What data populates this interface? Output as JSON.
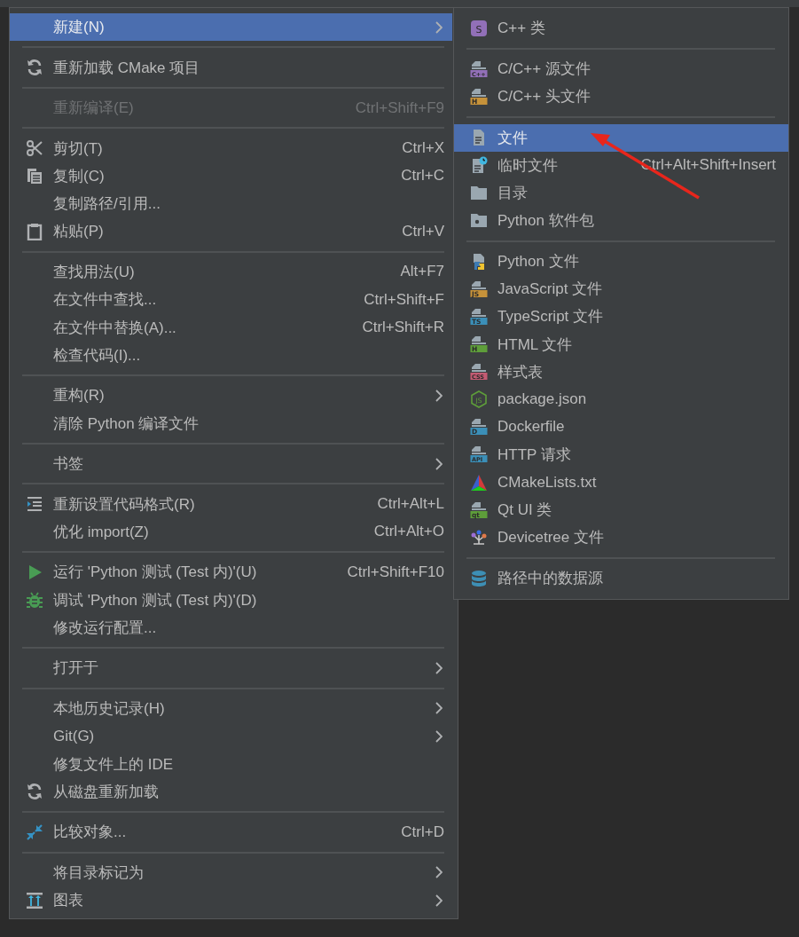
{
  "context_menu": {
    "items": [
      {
        "kind": "text",
        "label": "新建(N)",
        "submenu": true,
        "selected": true,
        "disabled": false
      },
      {
        "kind": "separator"
      },
      {
        "kind": "reload",
        "label": "重新加载 CMake 项目",
        "submenu": false,
        "selected": false,
        "disabled": false
      },
      {
        "kind": "separator"
      },
      {
        "kind": "text",
        "label": "重新编译(E)",
        "shortcut": "Ctrl+Shift+F9",
        "submenu": false,
        "selected": false,
        "disabled": true
      },
      {
        "kind": "separator"
      },
      {
        "kind": "scissors",
        "label": "剪切(T)",
        "shortcut": "Ctrl+X",
        "submenu": false,
        "selected": false,
        "disabled": false
      },
      {
        "kind": "copy",
        "label": "复制(C)",
        "shortcut": "Ctrl+C",
        "submenu": false,
        "selected": false,
        "disabled": false
      },
      {
        "kind": "text",
        "label": "复制路径/引用...",
        "submenu": false,
        "selected": false,
        "disabled": false
      },
      {
        "kind": "paste",
        "label": "粘贴(P)",
        "shortcut": "Ctrl+V",
        "submenu": false,
        "selected": false,
        "disabled": false
      },
      {
        "kind": "separator"
      },
      {
        "kind": "text",
        "label": "查找用法(U)",
        "shortcut": "Alt+F7",
        "submenu": false,
        "selected": false,
        "disabled": false
      },
      {
        "kind": "text",
        "label": "在文件中查找...",
        "shortcut": "Ctrl+Shift+F",
        "submenu": false,
        "selected": false,
        "disabled": false
      },
      {
        "kind": "text",
        "label": "在文件中替换(A)...",
        "shortcut": "Ctrl+Shift+R",
        "submenu": false,
        "selected": false,
        "disabled": false
      },
      {
        "kind": "text",
        "label": "检查代码(I)...",
        "submenu": false,
        "selected": false,
        "disabled": false
      },
      {
        "kind": "separator"
      },
      {
        "kind": "text",
        "label": "重构(R)",
        "submenu": true,
        "selected": false,
        "disabled": false
      },
      {
        "kind": "text",
        "label": "清除 Python 编译文件",
        "submenu": false,
        "selected": false,
        "disabled": false
      },
      {
        "kind": "separator"
      },
      {
        "kind": "text",
        "label": "书签",
        "submenu": true,
        "selected": false,
        "disabled": false
      },
      {
        "kind": "separator"
      },
      {
        "kind": "format",
        "label": "重新设置代码格式(R)",
        "shortcut": "Ctrl+Alt+L",
        "submenu": false,
        "selected": false,
        "disabled": false
      },
      {
        "kind": "text",
        "label": "优化 import(Z)",
        "shortcut": "Ctrl+Alt+O",
        "submenu": false,
        "selected": false,
        "disabled": false
      },
      {
        "kind": "separator"
      },
      {
        "kind": "run",
        "label": "运行 'Python 测试 (Test 内)'(U)",
        "shortcut": "Ctrl+Shift+F10",
        "submenu": false,
        "selected": false,
        "disabled": false
      },
      {
        "kind": "debug",
        "label": "调试 'Python 测试 (Test 内)'(D)",
        "submenu": false,
        "selected": false,
        "disabled": false
      },
      {
        "kind": "text",
        "label": "修改运行配置...",
        "submenu": false,
        "selected": false,
        "disabled": false
      },
      {
        "kind": "separator"
      },
      {
        "kind": "text",
        "label": "打开于",
        "submenu": true,
        "selected": false,
        "disabled": false
      },
      {
        "kind": "separator"
      },
      {
        "kind": "text",
        "label": "本地历史记录(H)",
        "submenu": true,
        "selected": false,
        "disabled": false
      },
      {
        "kind": "text",
        "label": "Git(G)",
        "submenu": true,
        "selected": false,
        "disabled": false
      },
      {
        "kind": "text",
        "label": "修复文件上的 IDE",
        "submenu": false,
        "selected": false,
        "disabled": false
      },
      {
        "kind": "reload",
        "label": "从磁盘重新加载",
        "submenu": false,
        "selected": false,
        "disabled": false
      },
      {
        "kind": "separator"
      },
      {
        "kind": "compare",
        "label": "比较对象...",
        "shortcut": "Ctrl+D",
        "submenu": false,
        "selected": false,
        "disabled": false
      },
      {
        "kind": "separator"
      },
      {
        "kind": "text",
        "label": "将目录标记为",
        "submenu": true,
        "selected": false,
        "disabled": false
      },
      {
        "kind": "diagram",
        "label": "图表",
        "submenu": true,
        "selected": false,
        "disabled": false
      }
    ]
  },
  "submenu": {
    "items": [
      {
        "kind": "class",
        "badge": "S",
        "color": "#9270b8",
        "label": "C++ 类",
        "selected": false
      },
      {
        "kind": "separator"
      },
      {
        "kind": "filetype",
        "badge": "C++",
        "color": "#9270b8",
        "label": "C/C++ 源文件",
        "selected": false
      },
      {
        "kind": "filetype",
        "badge": "H",
        "color": "#c6923a",
        "label": "C/C++ 头文件",
        "selected": false
      },
      {
        "kind": "separator"
      },
      {
        "kind": "file",
        "label": "文件",
        "selected": true
      },
      {
        "kind": "scratch",
        "label": "临时文件",
        "shortcut": "Ctrl+Alt+Shift+Insert",
        "selected": false
      },
      {
        "kind": "folder",
        "label": "目录",
        "selected": false
      },
      {
        "kind": "package",
        "label": "Python 软件包",
        "selected": false
      },
      {
        "kind": "separator"
      },
      {
        "kind": "python",
        "label": "Python 文件",
        "selected": false
      },
      {
        "kind": "filetype",
        "badge": "JS",
        "color": "#c6923a",
        "label": "JavaScript 文件",
        "selected": false
      },
      {
        "kind": "filetype",
        "badge": "TS",
        "color": "#3b8fb8",
        "label": "TypeScript 文件",
        "selected": false
      },
      {
        "kind": "filetype",
        "badge": "H",
        "color": "#5e9e3a",
        "label": "HTML 文件",
        "selected": false
      },
      {
        "kind": "filetype",
        "badge": "CSS",
        "color": "#c45b73",
        "label": "样式表",
        "selected": false
      },
      {
        "kind": "node",
        "badge": "JS",
        "label": "package.json",
        "selected": false
      },
      {
        "kind": "filetype",
        "badge": "D",
        "color": "#3b8fb8",
        "label": "Dockerfile",
        "selected": false
      },
      {
        "kind": "filetype",
        "badge": "API",
        "color": "#3b8fb8",
        "label": "HTTP 请求",
        "selected": false
      },
      {
        "kind": "cmake",
        "label": "CMakeLists.txt",
        "selected": false
      },
      {
        "kind": "filetype",
        "badge": "qt",
        "color": "#5e9e3a",
        "label": "Qt UI 类",
        "selected": false
      },
      {
        "kind": "devicetree",
        "label": "Devicetree 文件",
        "selected": false
      },
      {
        "kind": "separator"
      },
      {
        "kind": "database",
        "label": "路径中的数据源",
        "selected": false
      }
    ]
  },
  "annotations": [
    {
      "kind": "arrow"
    }
  ]
}
